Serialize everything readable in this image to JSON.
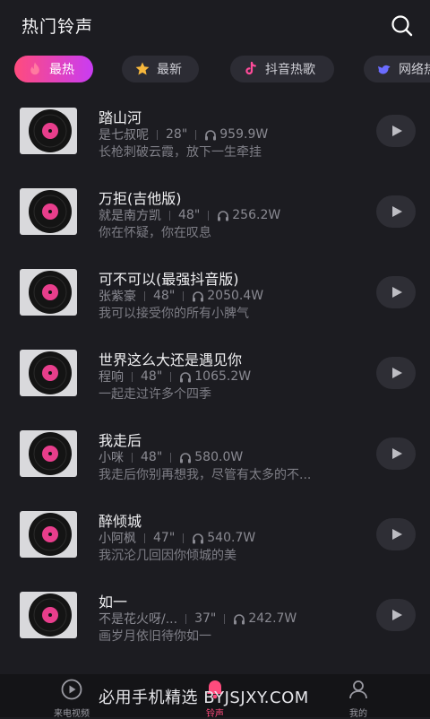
{
  "header": {
    "title": "热门铃声"
  },
  "tabs": [
    {
      "label": "最热",
      "icon": "flame-icon",
      "active": true
    },
    {
      "label": "最新",
      "icon": "star-icon",
      "active": false
    },
    {
      "label": "抖音热歌",
      "icon": "tiktok-icon",
      "active": false
    },
    {
      "label": "网络热",
      "icon": "bird-icon",
      "active": false
    }
  ],
  "songs": [
    {
      "title": "踏山河",
      "artist": "是七叔呢",
      "duration": "28\"",
      "plays": "959.9W",
      "lyric": "长枪刺破云霞，放下一生牵挂"
    },
    {
      "title": "万拒(吉他版)",
      "artist": "就是南方凯",
      "duration": "48\"",
      "plays": "256.2W",
      "lyric": "你在怀疑，你在叹息"
    },
    {
      "title": "可不可以(最强抖音版)",
      "artist": "张紫豪",
      "duration": "48\"",
      "plays": "2050.4W",
      "lyric": "我可以接受你的所有小脾气"
    },
    {
      "title": "世界这么大还是遇见你",
      "artist": "程响",
      "duration": "48\"",
      "plays": "1065.2W",
      "lyric": "一起走过许多个四季"
    },
    {
      "title": "我走后",
      "artist": "小咪",
      "duration": "48\"",
      "plays": "580.0W",
      "lyric": "我走后你别再想我，尽管有太多的不..."
    },
    {
      "title": "醉倾城",
      "artist": "小阿枫",
      "duration": "47\"",
      "plays": "540.7W",
      "lyric": "我沉沦几回因你倾城的美"
    },
    {
      "title": "如一",
      "artist": "不是花火呀/...",
      "duration": "37\"",
      "plays": "242.7W",
      "lyric": "画岁月依旧待你如一"
    }
  ],
  "bottom_nav": [
    {
      "label": "来电视频",
      "icon": "play-circle-icon",
      "active": false
    },
    {
      "label": "铃声",
      "icon": "bell-icon",
      "active": true
    },
    {
      "label": "我的",
      "icon": "user-icon",
      "active": false
    }
  ],
  "watermark": "必用手机精选 BYJSJXY.COM",
  "colors": {
    "accent_start": "#ff4b7d",
    "accent_end": "#c93cf3",
    "background": "#1c1c21",
    "disc_label": "#e83e8c"
  }
}
